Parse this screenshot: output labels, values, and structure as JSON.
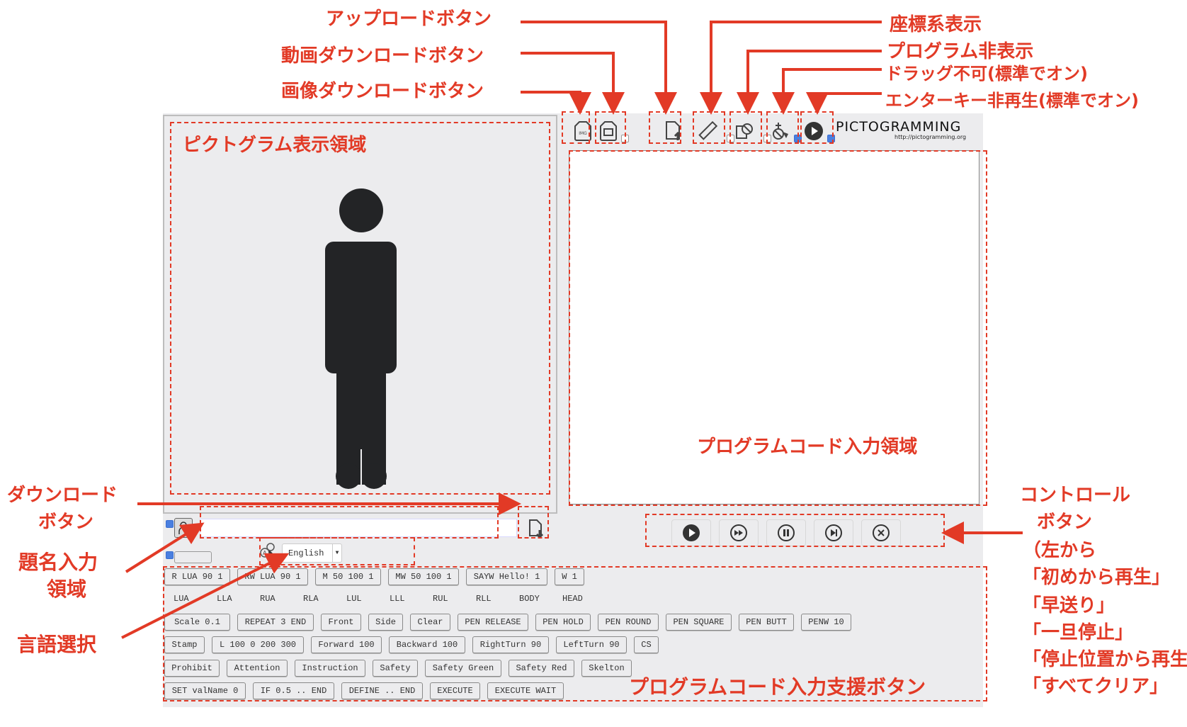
{
  "annotations": {
    "upload_button": "アップロードボタン",
    "video_download_button": "動画ダウンロードボタン",
    "image_download_button": "画像ダウンロードボタン",
    "coordinate_display": "座標系表示",
    "hide_program": "プログラム非表示",
    "drag_disabled": "ドラッグ不可(標準でオン)",
    "enter_no_play": "エンターキー非再生(標準でオン)",
    "pictogram_area": "ピクトグラム表示領域",
    "code_area": "プログラムコード入力領域",
    "download_button_line1": "ダウンロード",
    "download_button_line2": "ボタン",
    "title_input_line1": "題名入力",
    "title_input_line2": "領域",
    "language_select": "言語選択",
    "support_buttons": "プログラムコード入力支援ボタン",
    "control_buttons_lines": [
      "コントロール",
      "ボタン",
      "（左から",
      "「初めから再生」",
      "「早送り」",
      "「一旦停止」",
      "「停止位置から再生」",
      "「すべてクリア」"
    ]
  },
  "app": {
    "logo": "PICTOGRAMMING",
    "logo_url": "http://pictogramming.org",
    "toolbar": {
      "image_download_icon": "img-file-icon",
      "video_download_icon": "video-file-icon",
      "upload_icon": "file-upload-icon",
      "coordinate_icon": "ruler-icon",
      "hide_program_icon": "hide-code-icon",
      "drag_icon": "no-drag-icon",
      "enter_play_icon": "play-circle-icon",
      "video_download_checked": false,
      "coordinate_checked": false,
      "hide_program_checked": false,
      "drag_disabled_checked": true,
      "enter_no_play_checked": true
    },
    "title_input": {
      "value": "",
      "placeholder": ""
    },
    "title_checkbox_checked": true,
    "second_checkbox_checked": true,
    "language": {
      "selected": "English"
    },
    "controls": [
      {
        "name": "play-from-start",
        "icon": "play-icon"
      },
      {
        "name": "fast-forward",
        "icon": "fast-forward-icon"
      },
      {
        "name": "pause",
        "icon": "pause-icon"
      },
      {
        "name": "resume",
        "icon": "resume-icon"
      },
      {
        "name": "clear-all",
        "icon": "clear-icon"
      }
    ],
    "command_rows": [
      [
        "R LUA 90 1",
        "RW LUA 90 1",
        "M 50 100 1",
        "MW 50 100 1",
        "SAYW Hello! 1",
        "W 1"
      ],
      [
        "Scale  0.1",
        "REPEAT 3 END",
        "Front",
        "Side",
        "Clear",
        "PEN RELEASE",
        "PEN HOLD",
        "PEN ROUND",
        "PEN SQUARE",
        "PEN BUTT",
        "PENW 10"
      ],
      [
        "Stamp",
        "L 100 0 200 300",
        "Forward 100",
        "Backward 100",
        "RightTurn 90",
        "LeftTurn 90",
        "CS"
      ],
      [
        "Prohibit",
        "Attention",
        "Instruction",
        "Safety",
        "Safety Green",
        "Safety Red",
        "Skelton"
      ],
      [
        "SET valName 0",
        "IF 0.5 .. END",
        "DEFINE .. END",
        "EXECUTE",
        "EXECUTE WAIT"
      ]
    ],
    "body_parts": [
      "LUA",
      "LLA",
      "RUA",
      "RLA",
      "LUL",
      "LLL",
      "RUL",
      "RLL",
      "BODY",
      "HEAD"
    ]
  }
}
